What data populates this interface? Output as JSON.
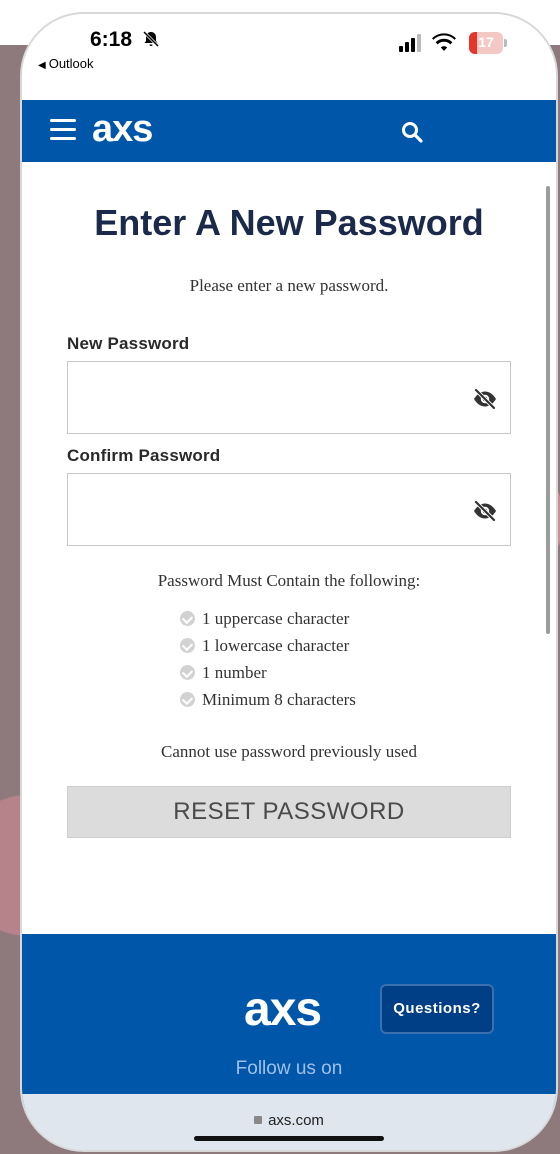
{
  "status_bar": {
    "time": "6:18",
    "back_app": "Outlook",
    "battery": "17",
    "icons": [
      "bell-slash-icon",
      "cellular-signal-icon",
      "wifi-icon",
      "battery-icon"
    ]
  },
  "header": {
    "logo": "axs",
    "icons": [
      "hamburger-menu-icon",
      "search-icon"
    ]
  },
  "form": {
    "title": "Enter A New Password",
    "subtitle": "Please enter a new password.",
    "new_password_label": "New Password",
    "new_password_value": "",
    "confirm_password_label": "Confirm Password",
    "confirm_password_value": "",
    "eye_icon": "eye-slash-icon",
    "requirements_title": "Password Must Contain the following:",
    "requirements": [
      "1 uppercase character",
      "1 lowercase character",
      "1 number",
      "Minimum 8 characters"
    ],
    "note": "Cannot use password previously used",
    "reset_button": "RESET PASSWORD"
  },
  "footer": {
    "logo": "axs",
    "questions_button": "Questions?",
    "follow_text": "Follow us on"
  },
  "browser": {
    "url": "axs.com"
  },
  "colors": {
    "brand_blue": "#0056a8",
    "title_navy": "#1b2a4a",
    "button_gray": "#dcdcdc"
  }
}
